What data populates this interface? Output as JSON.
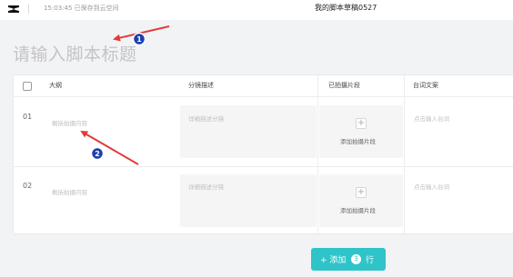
{
  "topbar": {
    "logo_icon": "capcut-logo-icon",
    "save_status": "15:03:45 已保存到云空间",
    "doc_title": "我的脚本草稿0527"
  },
  "script": {
    "title_placeholder": "请输入脚本标题"
  },
  "table": {
    "headers": {
      "outline": "大纲",
      "shot_desc": "分镜描述",
      "clips": "已拍摄片段",
      "lines": "台词文案"
    },
    "rows": [
      {
        "num": "01",
        "outline_placeholder": "概括拍摄内容",
        "desc_placeholder": "详细描述分镜",
        "add_clip_label": "添加拍摄片段",
        "lines_placeholder": "点击输入台词"
      },
      {
        "num": "02",
        "outline_placeholder": "概括拍摄内容",
        "desc_placeholder": "详细描述分镜",
        "add_clip_label": "添加拍摄片段",
        "lines_placeholder": "点击输入台词"
      }
    ]
  },
  "add_row": {
    "prefix": "+ 添加",
    "count": "3",
    "suffix": "行"
  },
  "annotations": {
    "marker_1": "1",
    "marker_2": "2",
    "arrow_color": "#e23b3b"
  },
  "colors": {
    "accent": "#2ec4c9"
  }
}
